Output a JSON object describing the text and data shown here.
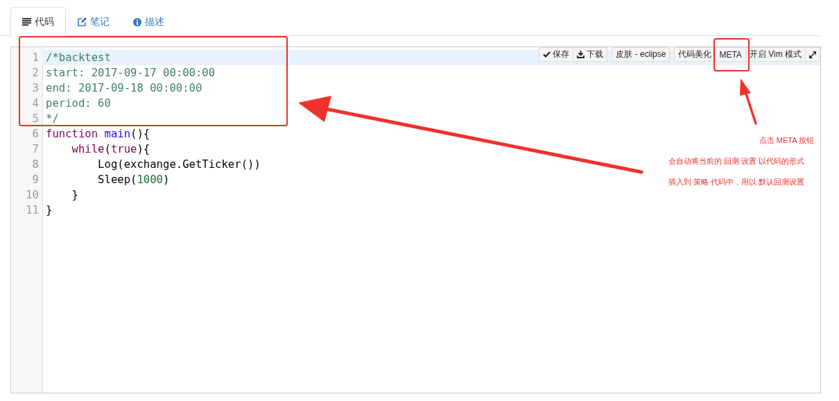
{
  "tabs": [
    {
      "label": "代码",
      "selected": true
    },
    {
      "label": "笔记",
      "selected": false
    },
    {
      "label": "描述",
      "selected": false
    }
  ],
  "toolbar": [
    {
      "label": "保存"
    },
    {
      "label": "下载"
    },
    {
      "label": "皮肤 - eclipse"
    },
    {
      "label": "代码美化"
    },
    {
      "label": "META"
    },
    {
      "label": "开启 Vim 模式"
    }
  ],
  "code_lines": [
    {
      "number": "1",
      "active": true,
      "tokens": [
        {
          "text": "/*backtest",
          "kind": "comment"
        }
      ]
    },
    {
      "number": "2",
      "active": false,
      "tokens": [
        {
          "text": "start: 2017-09-17 00:00:00",
          "kind": "comment"
        }
      ]
    },
    {
      "number": "3",
      "active": false,
      "tokens": [
        {
          "text": "end: 2017-09-18 00:00:00",
          "kind": "comment"
        }
      ]
    },
    {
      "number": "4",
      "active": false,
      "tokens": [
        {
          "text": "period: 60",
          "kind": "comment"
        }
      ]
    },
    {
      "number": "5",
      "active": false,
      "tokens": [
        {
          "text": "*/",
          "kind": "comment"
        }
      ]
    },
    {
      "number": "6",
      "active": false,
      "tokens": [
        {
          "text": "function",
          "kind": "keyword"
        },
        {
          "text": " main",
          "kind": "name"
        },
        {
          "text": "(){",
          "kind": "plain"
        }
      ]
    },
    {
      "number": "7",
      "active": false,
      "tokens": [
        {
          "text": "    while",
          "kind": "keyword"
        },
        {
          "text": "(",
          "kind": "plain"
        },
        {
          "text": "true",
          "kind": "keyword"
        },
        {
          "text": "){",
          "kind": "plain"
        }
      ]
    },
    {
      "number": "8",
      "active": false,
      "tokens": [
        {
          "text": "        Log(exchange.GetTicker())",
          "kind": "plain"
        }
      ]
    },
    {
      "number": "9",
      "active": false,
      "tokens": [
        {
          "text": "        Sleep(",
          "kind": "plain"
        },
        {
          "text": "1000",
          "kind": "number"
        },
        {
          "text": ")",
          "kind": "plain"
        }
      ]
    },
    {
      "number": "10",
      "active": false,
      "tokens": [
        {
          "text": "    }",
          "kind": "plain"
        }
      ]
    },
    {
      "number": "11",
      "active": false,
      "tokens": [
        {
          "text": "}",
          "kind": "plain"
        }
      ]
    }
  ],
  "annotation_notes": [
    "点击 META 按钮",
    "会自动将当前的 回测 设置 以代码的形式",
    "插入到 策略 代码中，用以 默认回测设置"
  ]
}
